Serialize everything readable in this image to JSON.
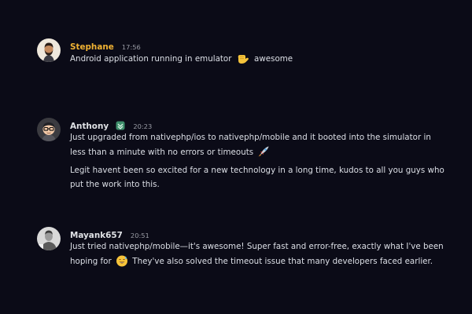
{
  "colors": {
    "background": "#0b0b17",
    "stephane_name": "#f0b233",
    "default_name": "#dfe1e5",
    "message_text": "#dcdfe6",
    "timestamp": "#9a9ca5"
  },
  "messages": [
    {
      "username": "Stephane",
      "timestamp": "17:56",
      "avatar_icon": "bearded-man-avatar-icon",
      "paragraphs": [
        {
          "before": "Android application running in emulator",
          "emoji": "call-me-hand-emoji-icon",
          "after": "awesome"
        }
      ]
    },
    {
      "username": "Anthony",
      "timestamp": "20:23",
      "badge_icon": "badge-icon",
      "avatar_icon": "glasses-avatar-icon",
      "paragraphs": [
        {
          "before": "Just upgraded from nativephp/ios to nativephp/mobile and it booted into the simulator in less than a minute with no errors or timeouts",
          "emoji": "rocket-emoji-icon",
          "after": ""
        },
        {
          "before": "Legit havent been so excited for a new technology in a long time, kudos to all you guys who put the work into this.",
          "emoji": "",
          "after": ""
        }
      ]
    },
    {
      "username": "Mayank657",
      "timestamp": "20:51",
      "avatar_icon": "grayscale-man-avatar-icon",
      "paragraphs": [
        {
          "before": "Just tried nativephp/mobile—it's awesome! Super fast and error-free, exactly what I've been hoping for",
          "emoji": "sweat-smile-emoji-icon",
          "after": "They've also solved the timeout issue that many developers faced earlier."
        }
      ]
    }
  ]
}
